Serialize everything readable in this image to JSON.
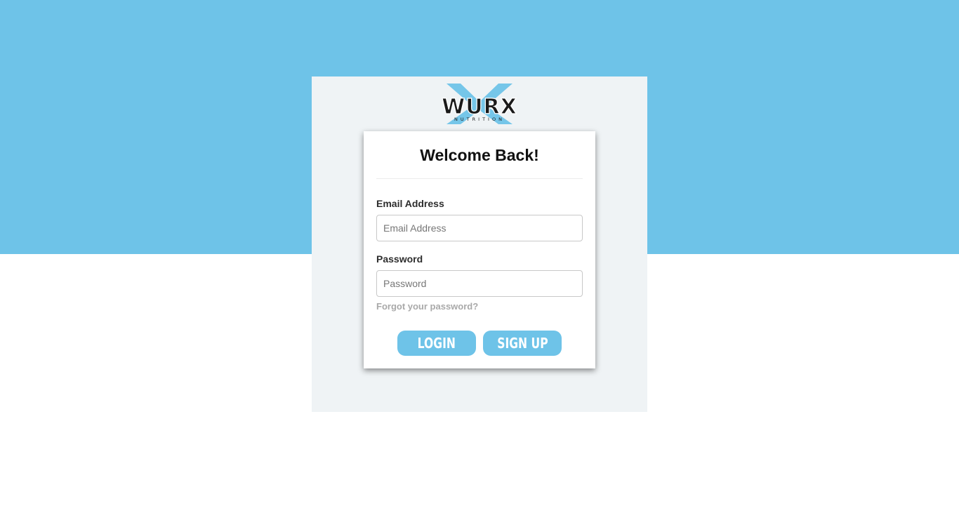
{
  "brand": {
    "logo_text": "WURX",
    "logo_subtext": "NUTRITION",
    "accent_color": "#6ec3e8"
  },
  "login_card": {
    "title": "Welcome Back!",
    "email": {
      "label": "Email Address",
      "placeholder": "Email Address",
      "value": ""
    },
    "password": {
      "label": "Password",
      "placeholder": "Password",
      "value": ""
    },
    "forgot_link": "Forgot your password?",
    "login_button": "LOGIN",
    "signup_button": "SIGN UP"
  }
}
